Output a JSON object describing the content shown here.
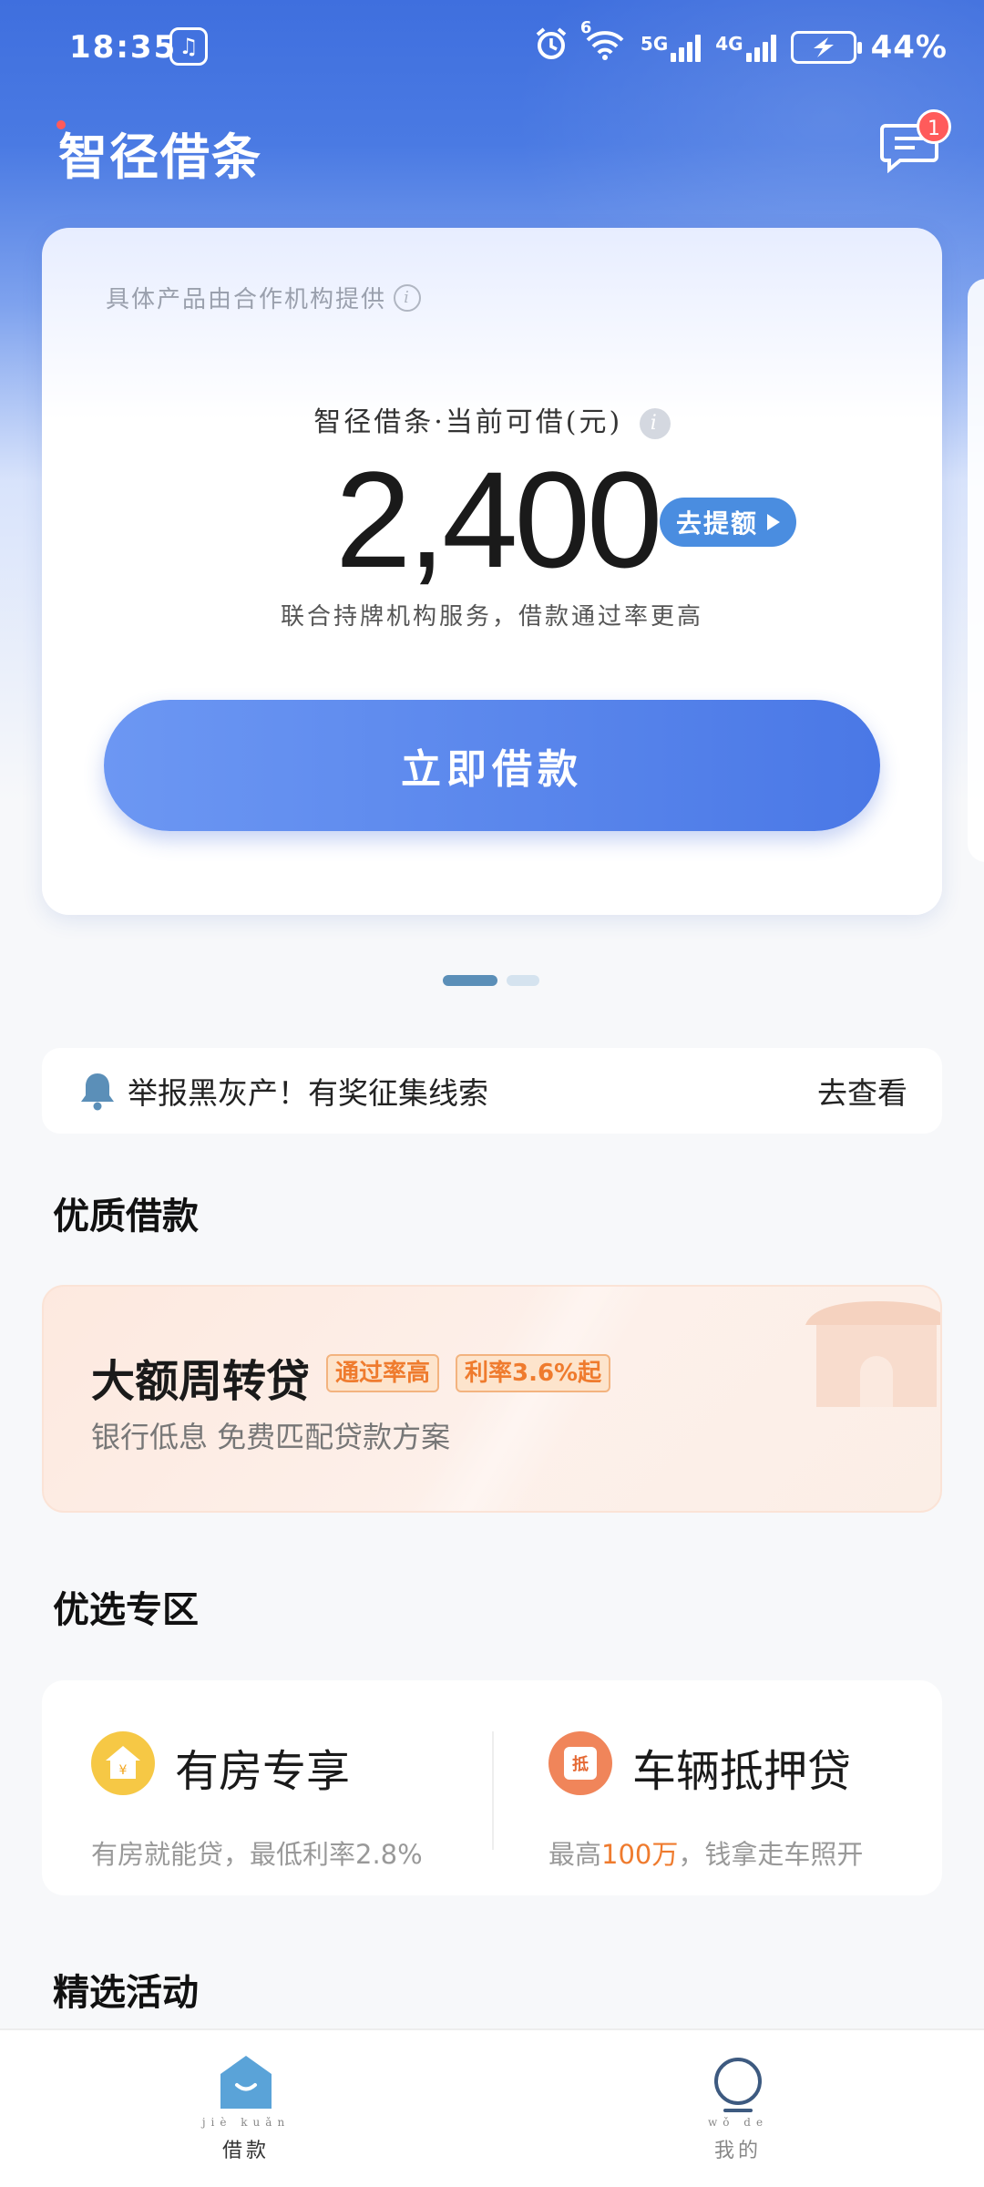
{
  "status_bar": {
    "time": "18:35",
    "network_5g": "5G",
    "network_4g": "4G",
    "wifi_label": "6",
    "battery": "44%",
    "icons": [
      "music-app-icon",
      "alarm-icon",
      "wifi-icon",
      "signal-icon",
      "battery-charging-icon"
    ]
  },
  "header": {
    "title": "智径借条",
    "message_badge": "1"
  },
  "loan_card": {
    "provider_note": "具体产品由合作机构提供",
    "amount_label": "智径借条·当前可借(元)",
    "amount": "2,400",
    "raise_button": "去提额",
    "sub_note": "联合持牌机构服务，借款通过率更高",
    "borrow_button": "立即借款",
    "carousel_pages": 2,
    "carousel_active": 1
  },
  "notice": {
    "text": "举报黑灰产！有奖征集线索",
    "action": "去查看"
  },
  "section_quality": {
    "title": "优质借款"
  },
  "promo": {
    "title": "大额周转贷",
    "tag1": "通过率高",
    "tag2": "利率3.6%起",
    "desc": "银行低息 免费匹配贷款方案"
  },
  "section_zone": {
    "title": "优选专区",
    "items": [
      {
        "title": "有房专享",
        "desc": "有房就能贷，最低利率2.8%",
        "icon": "house-coin-icon",
        "icon_char": "¥",
        "color": "#f6c845"
      },
      {
        "title": "车辆抵押贷",
        "desc_pre": "最高",
        "desc_hl": "100万",
        "desc_post": "，钱拿走车照开",
        "icon": "mortgage-icon",
        "icon_char": "抵",
        "color": "#f0855a"
      }
    ]
  },
  "section_activity": {
    "title": "精选活动"
  },
  "nav": {
    "tabs": [
      {
        "label": "借款",
        "pinyin": "jiè kuǎn",
        "active": true
      },
      {
        "label": "我的",
        "pinyin": "wǒ de",
        "active": false
      }
    ]
  },
  "colors": {
    "primary": "#4a78e6",
    "accent_orange": "#ef7b2e",
    "badge_red": "#ff5b5b"
  }
}
